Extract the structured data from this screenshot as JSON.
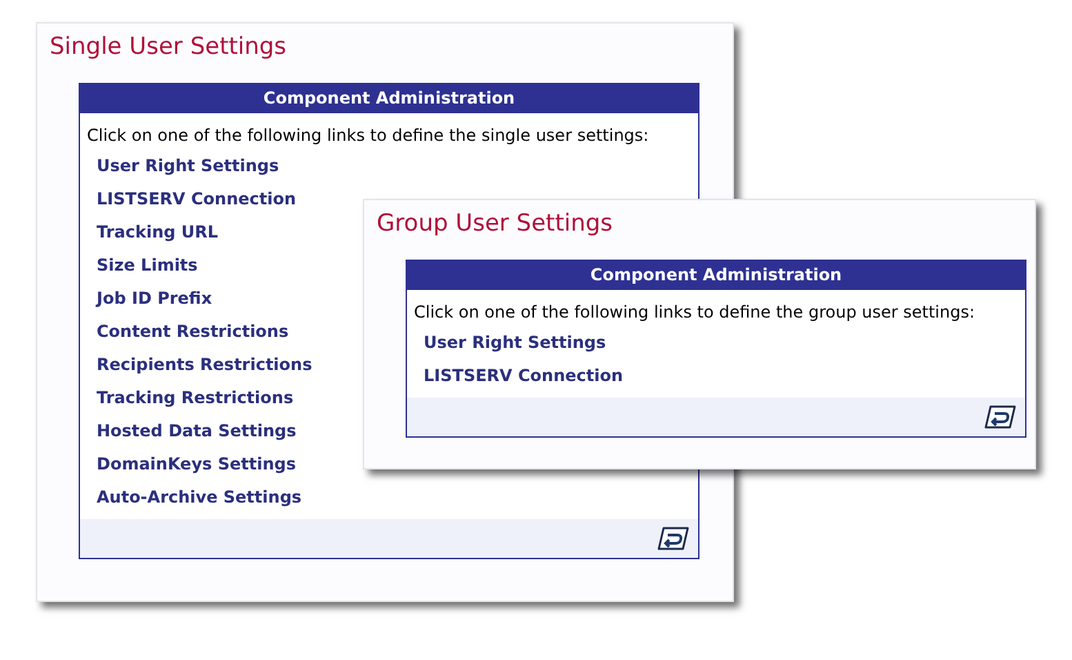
{
  "panels": [
    {
      "title": "Single User Settings",
      "header": "Component Administration",
      "intro": "Click on one of the following links to define the single user settings:",
      "links": [
        "User Right Settings",
        "LISTSERV Connection",
        "Tracking URL",
        "Size Limits",
        "Job ID Prefix",
        "Content Restrictions",
        "Recipients Restrictions",
        "Tracking Restrictions",
        "Hosted Data Settings",
        "DomainKeys Settings",
        "Auto-Archive Settings"
      ]
    },
    {
      "title": "Group User Settings",
      "header": "Component Administration",
      "intro": "Click on one of the following links to define the group user settings:",
      "links": [
        "User Right Settings",
        "LISTSERV Connection"
      ]
    }
  ]
}
